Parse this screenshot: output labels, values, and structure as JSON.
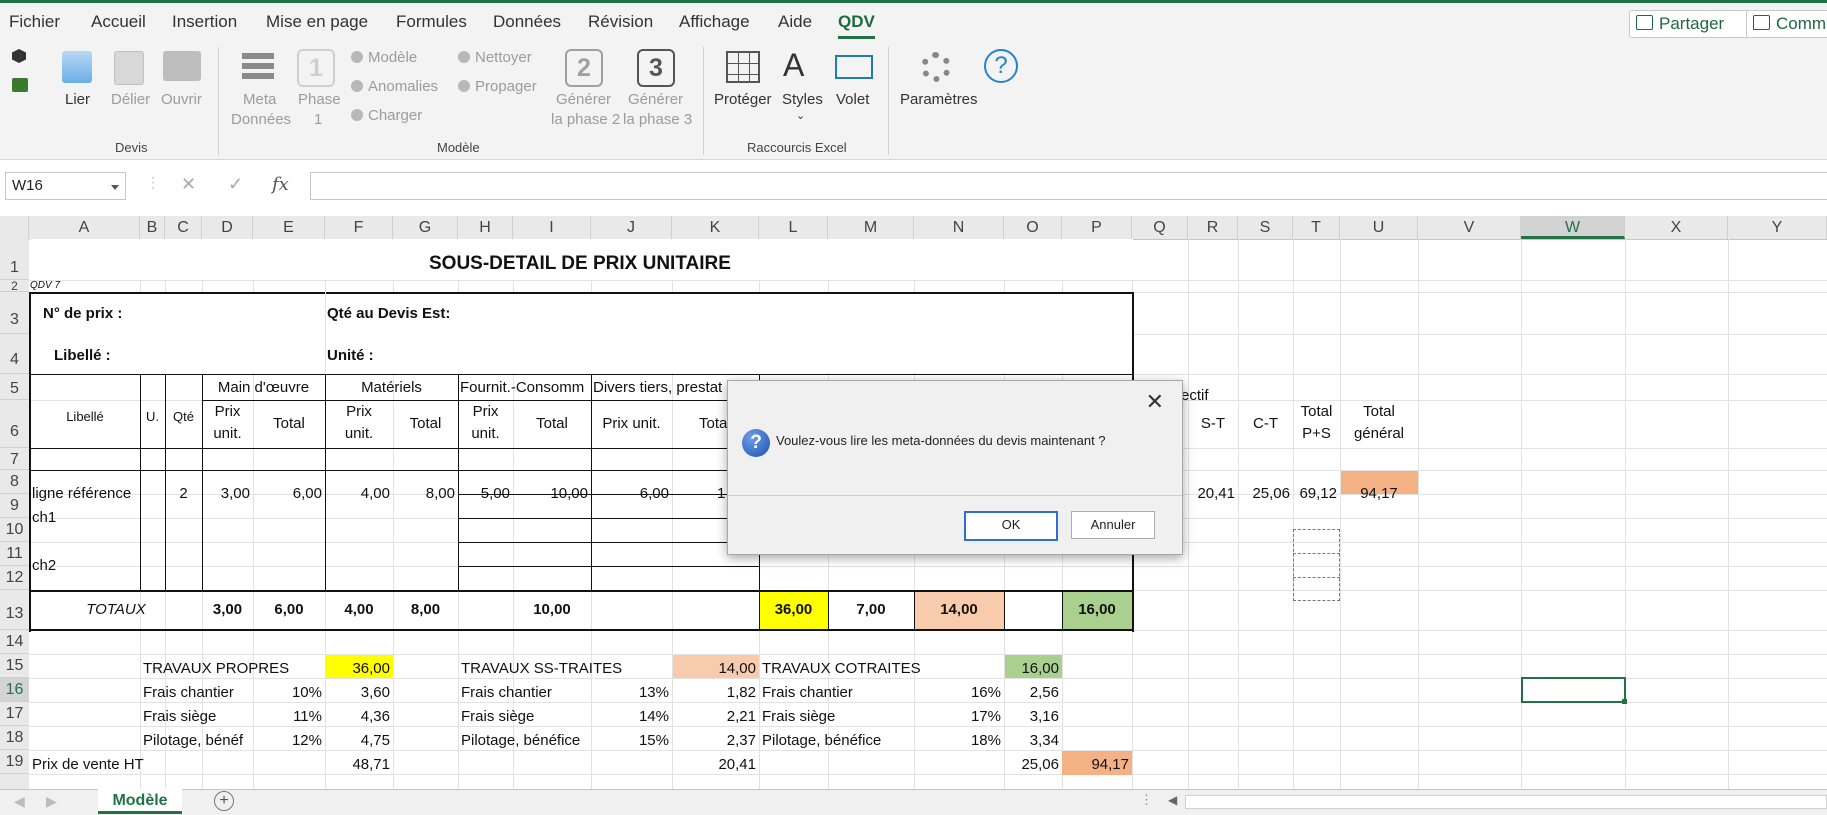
{
  "menu": {
    "items": [
      "Fichier",
      "Accueil",
      "Insertion",
      "Mise en page",
      "Formules",
      "Données",
      "Révision",
      "Affichage",
      "Aide",
      "QDV"
    ],
    "active": "QDV",
    "share_label": "Partager",
    "comments_label": "Comm"
  },
  "ribbon": {
    "devis": {
      "lier": "Lier",
      "delier": "Délier",
      "ouvrir": "Ouvrir",
      "group": "Devis"
    },
    "modele": {
      "meta_line1": "Meta",
      "meta_line2": "Données",
      "phase_line1": "Phase",
      "phase_line2": "1",
      "modele": "Modèle",
      "anomalies": "Anomalies",
      "charger": "Charger",
      "nettoyer": "Nettoyer",
      "propager": "Propager",
      "gen2_line1": "Générer",
      "gen2_line2": "la phase 2",
      "gen3_line1": "Générer",
      "gen3_line2": "la phase 3",
      "box1": "1",
      "box2": "2",
      "box3": "3",
      "group": "Modèle"
    },
    "raccourcis": {
      "proteger": "Protéger",
      "styles": "Styles",
      "volet": "Volet",
      "group": "Raccourcis Excel"
    },
    "parametres": "Paramètres"
  },
  "formula_bar": {
    "name_box": "W16",
    "fx": "fx",
    "value": ""
  },
  "columns": [
    "A",
    "B",
    "C",
    "D",
    "E",
    "F",
    "G",
    "H",
    "I",
    "J",
    "K",
    "L",
    "M",
    "N",
    "O",
    "P",
    "Q",
    "R",
    "S",
    "T",
    "U",
    "V",
    "W",
    "X",
    "Y"
  ],
  "rows": [
    "1",
    "2",
    "3",
    "4",
    "5",
    "6",
    "7",
    "8",
    "9",
    "10",
    "11",
    "12",
    "13",
    "14",
    "15",
    "16",
    "17",
    "18",
    "19"
  ],
  "sheet": {
    "title": "SOUS-DETAIL DE PRIX UNITAIRE",
    "qdv_version": "QDV 7",
    "no_prix_label": "N° de prix :",
    "qte_devis_label": "Qté au Devis Est:",
    "libelle_label": "Libellé :",
    "unite_label": "Unité :",
    "headers": {
      "main_oeuvre": "Main d'œuvre",
      "materiels": "Matériels",
      "fournit": "Fournit.-Consomm",
      "divers": "Divers tiers, prestat",
      "ectif": "ectif",
      "libelle": "Libellé",
      "u": "U.",
      "qte": "Qté",
      "prix": "Prix",
      "unit": "unit.",
      "total": "Total",
      "prix_unit": "Prix unit.",
      "tota": "Tota",
      "st": "S-T",
      "ct": "C-T",
      "total_ps_1": "Total",
      "total_ps_2": "P+S",
      "total_gen_1": "Total",
      "total_gen_2": "général"
    },
    "row8": {
      "label": "ligne référence",
      "qte": "2",
      "d": "3,00",
      "e": "6,00",
      "f": "4,00",
      "g": "8,00",
      "h": "5,00",
      "i": "10,00",
      "j": "6,00",
      "k": "1",
      "r": "20,41",
      "s": "25,06",
      "t": "69,12",
      "u": "94,17"
    },
    "ch1": "ch1",
    "ch2": "ch2",
    "totaux": {
      "label": "TOTAUX",
      "d": "3,00",
      "e": "6,00",
      "f": "4,00",
      "g": "8,00",
      "i": "10,00",
      "l": "36,00",
      "m": "7,00",
      "n": "14,00",
      "p": "16,00"
    },
    "propres": {
      "title": "TRAVAUX PROPRES",
      "value": "36,00",
      "rows": [
        {
          "label": "Frais chantier",
          "pct": "10%",
          "val": "3,60"
        },
        {
          "label": "Frais siège",
          "pct": "11%",
          "val": "4,36"
        },
        {
          "label": "Pilotage, bénéf",
          "pct": "12%",
          "val": "4,75"
        }
      ],
      "pv": "48,71"
    },
    "sstraites": {
      "title": "TRAVAUX SS-TRAITES",
      "value": "14,00",
      "rows": [
        {
          "label": "Frais chantier",
          "pct": "13%",
          "val": "1,82"
        },
        {
          "label": "Frais siège",
          "pct": "14%",
          "val": "2,21"
        },
        {
          "label": "Pilotage, bénéfice",
          "pct": "15%",
          "val": "2,37"
        }
      ],
      "pv": "20,41"
    },
    "cotraites": {
      "title": "TRAVAUX COTRAITES",
      "value": "16,00",
      "rows": [
        {
          "label": "Frais chantier",
          "pct": "16%",
          "val": "2,56"
        },
        {
          "label": "Frais siège",
          "pct": "17%",
          "val": "3,16"
        },
        {
          "label": "Pilotage, bénéfice",
          "pct": "18%",
          "val": "3,34"
        }
      ],
      "pv": "25,06"
    },
    "prix_vente_label": "Prix de vente HT",
    "prix_vente_total": "94,17"
  },
  "dialog": {
    "message": "Voulez-vous lire les meta-données du devis maintenant ?",
    "ok": "OK",
    "cancel": "Annuler",
    "icon": "question-icon"
  },
  "tabs": {
    "sheet": "Modèle"
  },
  "colors": {
    "accent": "#217346",
    "yellow": "#ffff00",
    "salmon": "#f8cbad",
    "green": "#a9d08e",
    "orange": "#f4b183"
  }
}
